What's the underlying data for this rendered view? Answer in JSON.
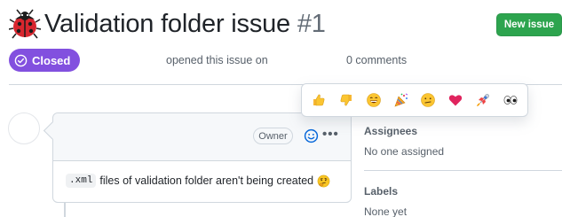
{
  "issue": {
    "title": "Validation folder issue",
    "number": "#1",
    "status": "Closed",
    "opened_text": "opened this issue on",
    "comments_text": "0 comments"
  },
  "header": {
    "new_issue_label": "New issue"
  },
  "comment": {
    "role_badge": "Owner",
    "code_text": ".xml",
    "body_text": "files of validation folder aren't being created"
  },
  "reactions": [
    {
      "name": "thumbs-up",
      "icon": "thumbs-up-icon"
    },
    {
      "name": "thumbs-down",
      "icon": "thumbs-down-icon"
    },
    {
      "name": "laugh",
      "icon": "laugh-icon"
    },
    {
      "name": "hooray",
      "icon": "party-popper-icon"
    },
    {
      "name": "confused",
      "icon": "confused-icon"
    },
    {
      "name": "heart",
      "icon": "heart-icon"
    },
    {
      "name": "rocket",
      "icon": "rocket-icon"
    },
    {
      "name": "eyes",
      "icon": "eyes-icon"
    }
  ],
  "sidebar": {
    "assignees_heading": "Assignees",
    "assignees_value": "No one assigned",
    "labels_heading": "Labels",
    "labels_value": "None yet"
  },
  "colors": {
    "closed_badge": "#8250df",
    "new_issue_button": "#2da44e",
    "accent_blue": "#0969da"
  }
}
